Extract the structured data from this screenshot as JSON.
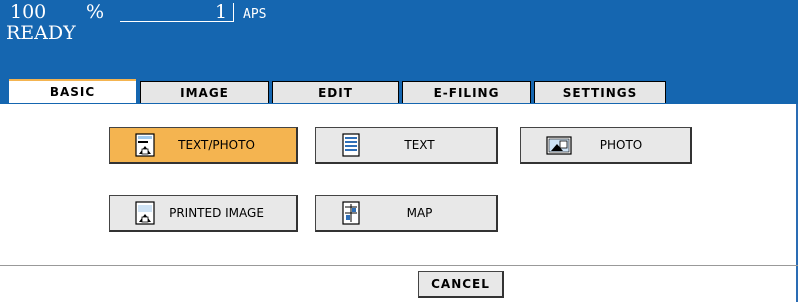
{
  "status": {
    "zoom_value": "100",
    "zoom_unit": "%",
    "copies": "1",
    "paper": "APS",
    "state": "READY"
  },
  "tabs": [
    {
      "label": "BASIC",
      "active": true
    },
    {
      "label": "IMAGE",
      "active": false
    },
    {
      "label": "EDIT",
      "active": false
    },
    {
      "label": "E-FILING",
      "active": false
    },
    {
      "label": "SETTINGS",
      "active": false
    }
  ],
  "modes": [
    {
      "label": "TEXT/PHOTO",
      "icon": "text-photo-icon",
      "selected": true
    },
    {
      "label": "TEXT",
      "icon": "text-document-icon",
      "selected": false
    },
    {
      "label": "PHOTO",
      "icon": "photo-icon",
      "selected": false
    },
    {
      "label": "PRINTED IMAGE",
      "icon": "printed-image-icon",
      "selected": false
    },
    {
      "label": "MAP",
      "icon": "map-icon",
      "selected": false
    }
  ],
  "actions": {
    "cancel_label": "CANCEL"
  },
  "colors": {
    "header_blue": "#1566b0",
    "selected_orange": "#f4b450",
    "button_gray": "#e8e8e8"
  }
}
